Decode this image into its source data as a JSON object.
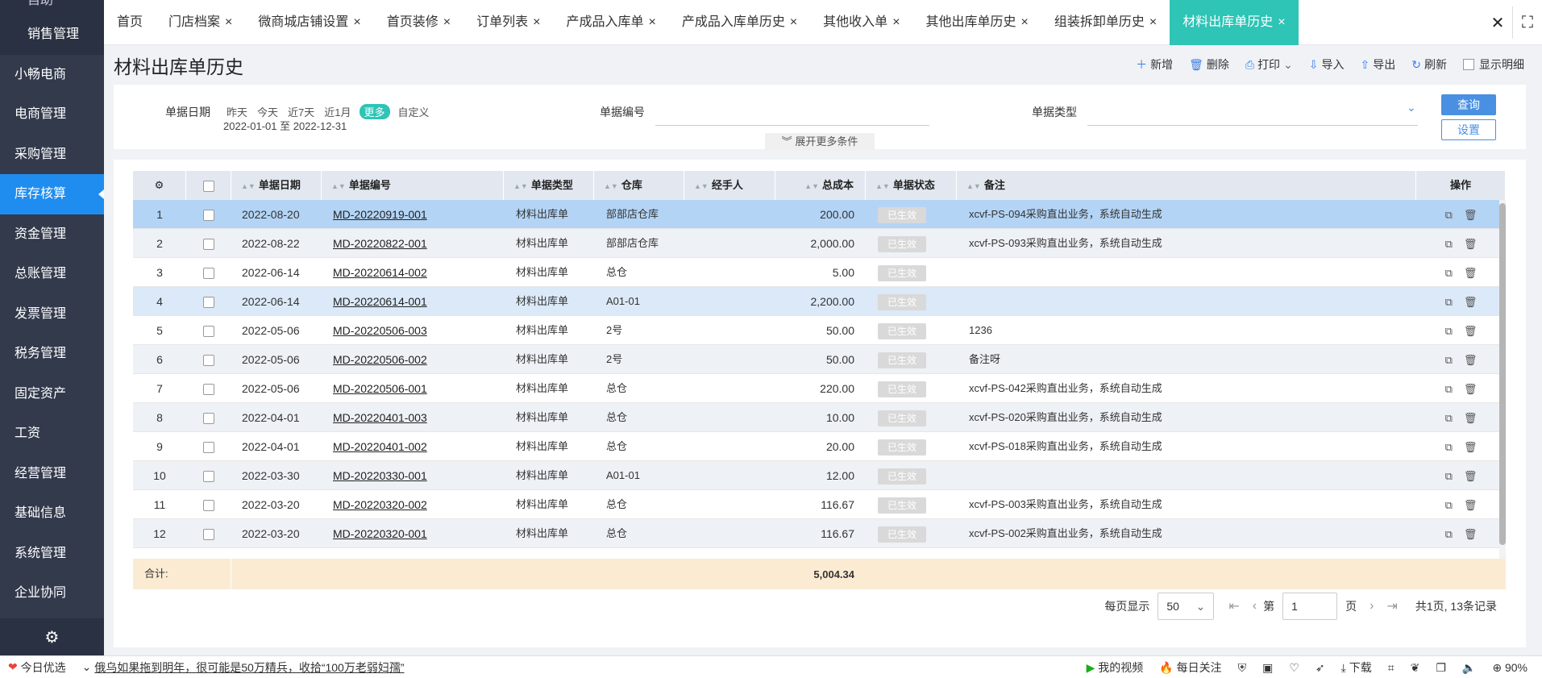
{
  "sidebar": {
    "cut_item": "自助",
    "items": [
      {
        "label": "销售管理",
        "sub": true
      },
      {
        "label": "小畅电商"
      },
      {
        "label": "电商管理"
      },
      {
        "label": "采购管理"
      },
      {
        "label": "库存核算",
        "active": true
      },
      {
        "label": "资金管理"
      },
      {
        "label": "总账管理"
      },
      {
        "label": "发票管理"
      },
      {
        "label": "税务管理"
      },
      {
        "label": "固定资产"
      },
      {
        "label": "工资"
      },
      {
        "label": "经营管理"
      },
      {
        "label": "基础信息"
      },
      {
        "label": "系统管理"
      },
      {
        "label": "企业协同"
      }
    ]
  },
  "tabs": [
    {
      "label": "首页",
      "closable": false
    },
    {
      "label": "门店档案",
      "closable": true
    },
    {
      "label": "微商城店铺设置",
      "closable": true
    },
    {
      "label": "首页装修",
      "closable": true
    },
    {
      "label": "订单列表",
      "closable": true
    },
    {
      "label": "产成品入库单",
      "closable": true
    },
    {
      "label": "产成品入库单历史",
      "closable": true
    },
    {
      "label": "其他收入单",
      "closable": true
    },
    {
      "label": "其他出库单历史",
      "closable": true
    },
    {
      "label": "组装拆卸单历史",
      "closable": true
    },
    {
      "label": "材料出库单历史",
      "closable": true,
      "active": true
    }
  ],
  "page_title": "材料出库单历史",
  "toolbar": {
    "add": "新增",
    "delete": "删除",
    "print": "打印",
    "import": "导入",
    "export": "导出",
    "refresh": "刷新",
    "show_detail": "显示明细"
  },
  "filter": {
    "date_label": "单据日期",
    "quick_dates": [
      "昨天",
      "今天",
      "近7天",
      "近1月",
      "更多",
      "自定义"
    ],
    "date_range": "2022-01-01 至 2022-12-31",
    "number_label": "单据编号",
    "number_value": "",
    "type_label": "单据类型",
    "type_value": "",
    "expand_label": "展开更多条件",
    "query_button": "查询",
    "settings_button": "设置"
  },
  "table": {
    "columns": [
      "单据日期",
      "单据编号",
      "单据类型",
      "仓库",
      "经手人",
      "总成本",
      "单据状态",
      "备注",
      "操作"
    ],
    "rows": [
      {
        "no": "1",
        "date": "2022-08-20",
        "code": "MD-20220919-001",
        "type": "材料出库单",
        "warehouse": "部部店仓库",
        "handler": "",
        "cost": "200.00",
        "status": "已生效",
        "note": "xcvf-PS-094采购直出业务，系统自动生成"
      },
      {
        "no": "2",
        "date": "2022-08-22",
        "code": "MD-20220822-001",
        "type": "材料出库单",
        "warehouse": "部部店仓库",
        "handler": "",
        "cost": "2,000.00",
        "status": "已生效",
        "note": "xcvf-PS-093采购直出业务，系统自动生成"
      },
      {
        "no": "3",
        "date": "2022-06-14",
        "code": "MD-20220614-002",
        "type": "材料出库单",
        "warehouse": "总仓",
        "handler": "",
        "cost": "5.00",
        "status": "已生效",
        "note": ""
      },
      {
        "no": "4",
        "date": "2022-06-14",
        "code": "MD-20220614-001",
        "type": "材料出库单",
        "warehouse": "A01-01",
        "handler": "",
        "cost": "2,200.00",
        "status": "已生效",
        "note": ""
      },
      {
        "no": "5",
        "date": "2022-05-06",
        "code": "MD-20220506-003",
        "type": "材料出库单",
        "warehouse": "2号",
        "handler": "",
        "cost": "50.00",
        "status": "已生效",
        "note": "1236"
      },
      {
        "no": "6",
        "date": "2022-05-06",
        "code": "MD-20220506-002",
        "type": "材料出库单",
        "warehouse": "2号",
        "handler": "",
        "cost": "50.00",
        "status": "已生效",
        "note": "备注呀"
      },
      {
        "no": "7",
        "date": "2022-05-06",
        "code": "MD-20220506-001",
        "type": "材料出库单",
        "warehouse": "总仓",
        "handler": "",
        "cost": "220.00",
        "status": "已生效",
        "note": "xcvf-PS-042采购直出业务，系统自动生成"
      },
      {
        "no": "8",
        "date": "2022-04-01",
        "code": "MD-20220401-003",
        "type": "材料出库单",
        "warehouse": "总仓",
        "handler": "",
        "cost": "10.00",
        "status": "已生效",
        "note": "xcvf-PS-020采购直出业务，系统自动生成"
      },
      {
        "no": "9",
        "date": "2022-04-01",
        "code": "MD-20220401-002",
        "type": "材料出库单",
        "warehouse": "总仓",
        "handler": "",
        "cost": "20.00",
        "status": "已生效",
        "note": "xcvf-PS-018采购直出业务，系统自动生成"
      },
      {
        "no": "10",
        "date": "2022-03-30",
        "code": "MD-20220330-001",
        "type": "材料出库单",
        "warehouse": "A01-01",
        "handler": "",
        "cost": "12.00",
        "status": "已生效",
        "note": ""
      },
      {
        "no": "11",
        "date": "2022-03-20",
        "code": "MD-20220320-002",
        "type": "材料出库单",
        "warehouse": "总仓",
        "handler": "",
        "cost": "116.67",
        "status": "已生效",
        "note": "xcvf-PS-003采购直出业务，系统自动生成"
      },
      {
        "no": "12",
        "date": "2022-03-20",
        "code": "MD-20220320-001",
        "type": "材料出库单",
        "warehouse": "总仓",
        "handler": "",
        "cost": "116.67",
        "status": "已生效",
        "note": "xcvf-PS-002采购直出业务，系统自动生成"
      }
    ],
    "total_label": "合计:",
    "total_cost": "5,004.34"
  },
  "pager": {
    "per_page_label": "每页显示",
    "per_page": "50",
    "page_prefix": "第",
    "page_value": "1",
    "page_suffix": "页",
    "summary": "共1页, 13条记录"
  },
  "statusbar": {
    "weather": "今日优选",
    "news": "俄乌如果拖到明年，很可能是50万精兵，收拾“100万老弱妇孺”",
    "video": "我的视频",
    "daily": "每日关注",
    "download": "下载",
    "zoom": "90%"
  }
}
